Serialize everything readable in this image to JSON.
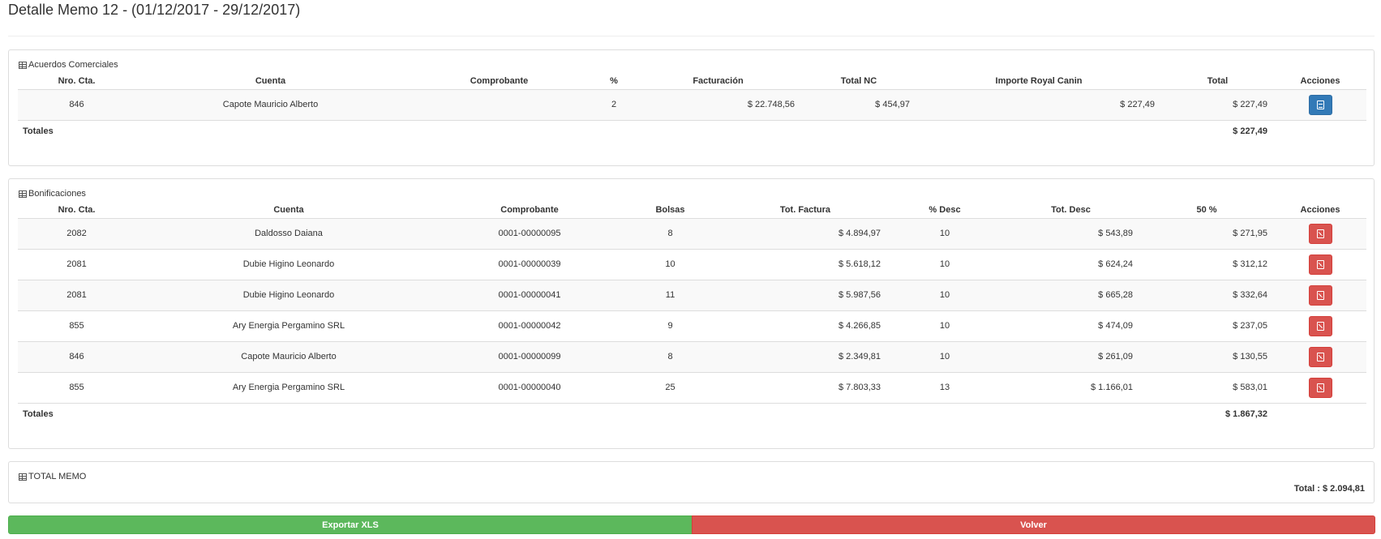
{
  "page": {
    "title": "Detalle Memo 12 - (01/12/2017 - 29/12/2017)"
  },
  "acuerdos": {
    "heading": "Acuerdos Comerciales",
    "columns": [
      "Nro. Cta.",
      "Cuenta",
      "Comprobante",
      "%",
      "Facturación",
      "Total NC",
      "Importe Royal Canin",
      "Total",
      "Acciones"
    ],
    "rows": [
      {
        "nro_cta": "846",
        "cuenta": "Capote Mauricio Alberto",
        "comprobante": "",
        "pct": "2",
        "facturacion": "$ 22.748,56",
        "total_nc": "$ 454,97",
        "importe_royal_canin": "$ 227,49",
        "total": "$ 227,49",
        "action_icon": "file-icon"
      }
    ],
    "totals_label": "Totales",
    "totals_value": "$ 227,49"
  },
  "bonificaciones": {
    "heading": "Bonificaciones",
    "columns": [
      "Nro. Cta.",
      "Cuenta",
      "Comprobante",
      "Bolsas",
      "Tot. Factura",
      "% Desc",
      "Tot. Desc",
      "50 %",
      "Acciones"
    ],
    "rows": [
      {
        "nro_cta": "2082",
        "cuenta": "Daldosso Daiana",
        "comprobante": "0001-00000095",
        "bolsas": "8",
        "tot_factura": "$ 4.894,97",
        "pct_desc": "10",
        "tot_desc": "$ 543,89",
        "cincuenta": "$ 271,95",
        "action_icon": "pdf-icon"
      },
      {
        "nro_cta": "2081",
        "cuenta": "Dubie Higino Leonardo",
        "comprobante": "0001-00000039",
        "bolsas": "10",
        "tot_factura": "$ 5.618,12",
        "pct_desc": "10",
        "tot_desc": "$ 624,24",
        "cincuenta": "$ 312,12",
        "action_icon": "pdf-icon"
      },
      {
        "nro_cta": "2081",
        "cuenta": "Dubie Higino Leonardo",
        "comprobante": "0001-00000041",
        "bolsas": "11",
        "tot_factura": "$ 5.987,56",
        "pct_desc": "10",
        "tot_desc": "$ 665,28",
        "cincuenta": "$ 332,64",
        "action_icon": "pdf-icon"
      },
      {
        "nro_cta": "855",
        "cuenta": "Ary Energia Pergamino SRL",
        "comprobante": "0001-00000042",
        "bolsas": "9",
        "tot_factura": "$ 4.266,85",
        "pct_desc": "10",
        "tot_desc": "$ 474,09",
        "cincuenta": "$ 237,05",
        "action_icon": "pdf-icon"
      },
      {
        "nro_cta": "846",
        "cuenta": "Capote Mauricio Alberto",
        "comprobante": "0001-00000099",
        "bolsas": "8",
        "tot_factura": "$ 2.349,81",
        "pct_desc": "10",
        "tot_desc": "$ 261,09",
        "cincuenta": "$ 130,55",
        "action_icon": "pdf-icon"
      },
      {
        "nro_cta": "855",
        "cuenta": "Ary Energia Pergamino SRL",
        "comprobante": "0001-00000040",
        "bolsas": "25",
        "tot_factura": "$ 7.803,33",
        "pct_desc": "13",
        "tot_desc": "$ 1.166,01",
        "cincuenta": "$ 583,01",
        "action_icon": "pdf-icon"
      }
    ],
    "totals_label": "Totales",
    "totals_value": "$ 1.867,32"
  },
  "total_memo": {
    "heading": "TOTAL MEMO",
    "value": "Total : $ 2.094,81"
  },
  "actions": {
    "export_label": "Exportar XLS",
    "back_label": "Volver"
  },
  "colors": {
    "primary": "#337ab7",
    "danger": "#d9534f",
    "success": "#5cb85c"
  }
}
